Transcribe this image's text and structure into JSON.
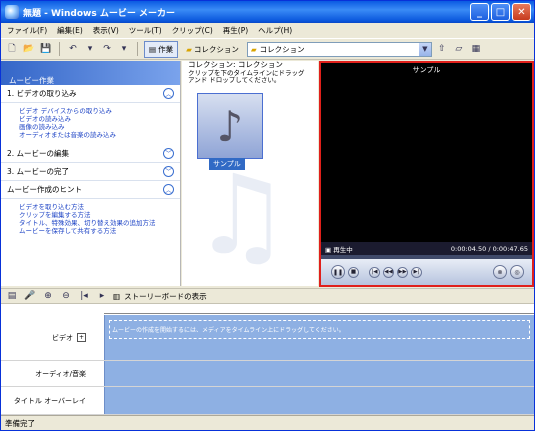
{
  "window": {
    "title": "無題 - Windows ムービー メーカー"
  },
  "menu": [
    "ファイル(F)",
    "編集(E)",
    "表示(V)",
    "ツール(T)",
    "クリップ(C)",
    "再生(P)",
    "ヘルプ(H)"
  ],
  "toolbar": {
    "tasks_label": "作業",
    "collections_label": "コレクション",
    "collection_select": "コレクション"
  },
  "taskpane": {
    "title": "ムービー作業",
    "sections": [
      {
        "title": "1. ビデオの取り込み",
        "links": [
          "ビデオ デバイスからの取り込み",
          "ビデオの読み込み",
          "画像の読み込み",
          "オーディオまたは音楽の読み込み"
        ]
      },
      {
        "title": "2. ムービーの編集",
        "links": []
      },
      {
        "title": "3. ムービーの完了",
        "links": []
      },
      {
        "title": "ムービー作成のヒント",
        "links": [
          "ビデオを取り込む方法",
          "クリップを編集する方法",
          "タイトル、特殊効果、切り替え効果の追加方法",
          "ムービーを保存して共有する方法"
        ]
      }
    ]
  },
  "collection": {
    "header": "コレクション: コレクション",
    "hint": "クリップを下のタイムラインにドラッグ アンド ドロップしてください。",
    "clip_label": "サンプル"
  },
  "preview": {
    "title": "サンプル",
    "status": "再生中",
    "time": "0:00:04.50 / 0:00:47.65"
  },
  "timeline": {
    "storyboard_label": "ストーリーボードの表示",
    "rows": [
      "ビデオ",
      "オーディオ/音楽",
      "タイトル オーバーレイ"
    ],
    "hint": "ムービーの作成を開始するには、メディアをタイムライン上にドラッグしてください。"
  },
  "status": {
    "text": "準備完了"
  }
}
